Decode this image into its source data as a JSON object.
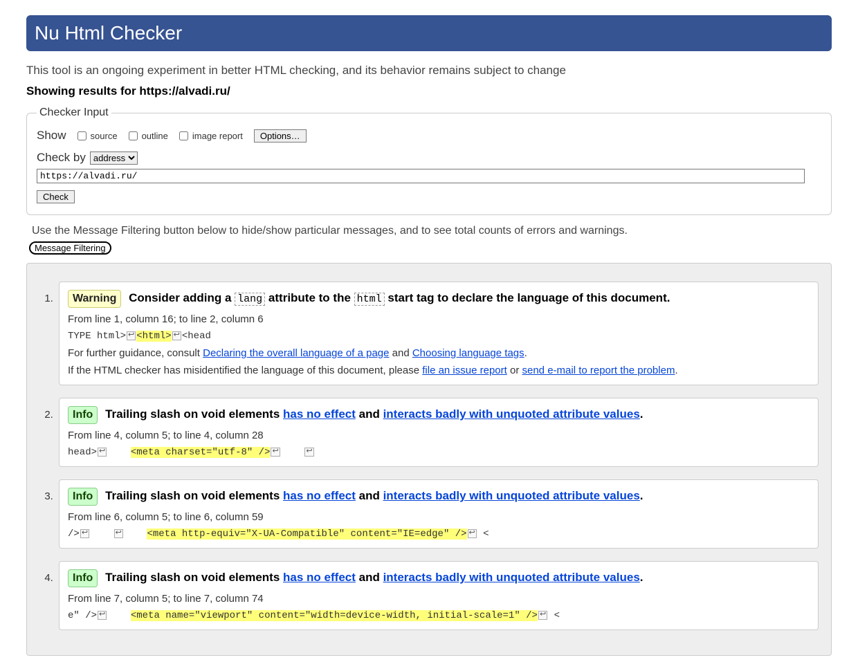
{
  "header": {
    "title": "Nu Html Checker",
    "subtitle": "This tool is an ongoing experiment in better HTML checking, and its behavior remains subject to change",
    "results_prefix": "Showing results for ",
    "results_url": "https://alvadi.ru/"
  },
  "checker": {
    "legend": "Checker Input",
    "show_label": "Show",
    "cb_source": "source",
    "cb_outline": "outline",
    "cb_image": "image report",
    "options_btn": "Options…",
    "checkby_label": "Check by",
    "checkby_value": "address",
    "url_value": "https://alvadi.ru/",
    "check_btn": "Check"
  },
  "filter": {
    "hint": "Use the Message Filtering button below to hide/show particular messages, and to see total counts of errors and warnings.",
    "btn": "Message Filtering"
  },
  "msg1": {
    "badge": "Warning",
    "head_a": "Consider adding a ",
    "chip1": "lang",
    "head_b": " attribute to the ",
    "chip2": "html",
    "head_c": " start tag to declare the language of this document.",
    "loc": "From line 1, column 16; to line 2, column 6",
    "code_pre": "TYPE html>",
    "code_hl": "<html>",
    "code_post": "<head",
    "g_pre": "For further guidance, consult ",
    "g_link1": "Declaring the overall language of a page",
    "g_mid": " and ",
    "g_link2": "Choosing language tags",
    "g_post": ".",
    "mis_pre": "If the HTML checker has misidentified the language of this document, please ",
    "mis_link1": "file an issue report",
    "mis_mid": " or ",
    "mis_link2": "send e-mail to report the problem",
    "mis_post": "."
  },
  "common": {
    "info_badge": "Info",
    "trail_pre": "Trailing slash on void elements ",
    "trail_link1": "has no effect",
    "trail_mid": " and ",
    "trail_link2": "interacts badly with unquoted attribute values",
    "trail_post": "."
  },
  "msg2": {
    "loc": "From line 4, column 5; to line 4, column 28",
    "code_pre": "head>",
    "code_hl": "<meta charset=\"utf-8\" />",
    "code_post": ""
  },
  "msg3": {
    "loc": "From line 6, column 5; to line 6, column 59",
    "code_pre": " />",
    "code_hl": "<meta http-equiv=\"X-UA-Compatible\" content=\"IE=edge\" />",
    "code_post": "    <"
  },
  "msg4": {
    "loc": "From line 7, column 5; to line 7, column 74",
    "code_pre": "e\" />",
    "code_hl": "<meta name=\"viewport\" content=\"width=device-width, initial-scale=1\" />",
    "code_post": "    <"
  }
}
